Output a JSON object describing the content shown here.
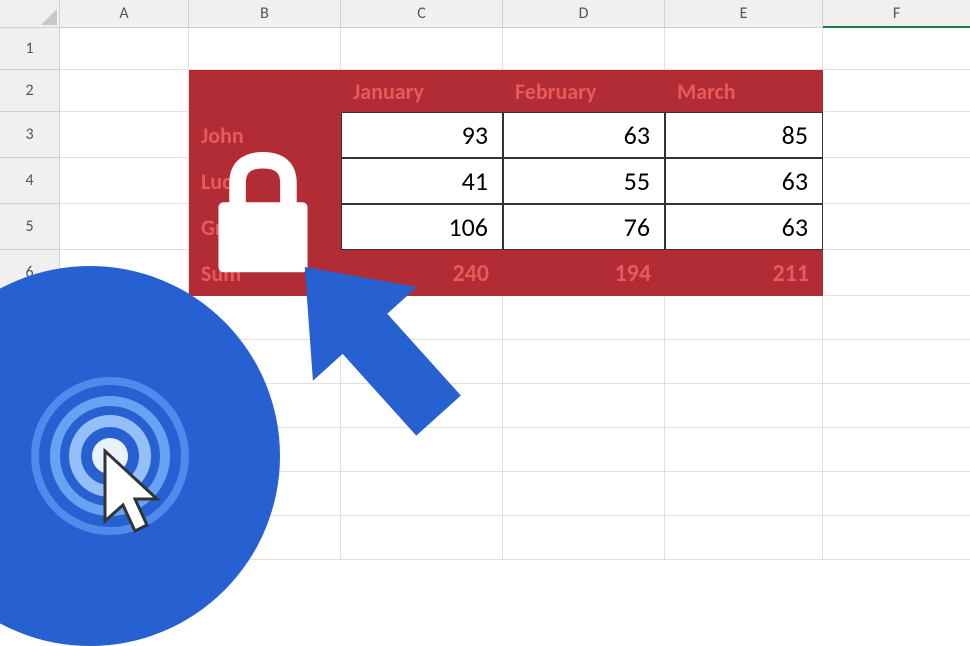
{
  "columns": [
    "A",
    "B",
    "C",
    "D",
    "E",
    "F"
  ],
  "rows": [
    "1",
    "2",
    "3",
    "4",
    "5",
    "6"
  ],
  "selected_column": "F",
  "table": {
    "months": {
      "c": "January",
      "d": "February",
      "e": "March"
    },
    "names": {
      "r3": "John",
      "r4": "Lucy",
      "r5": "Grace"
    },
    "data": {
      "r3": {
        "c": "93",
        "d": "63",
        "e": "85"
      },
      "r4": {
        "c": "41",
        "d": "55",
        "e": "63"
      },
      "r5": {
        "c": "106",
        "d": "76",
        "e": "63"
      }
    },
    "sum_label": "Sum",
    "sums": {
      "c": "240",
      "d": "194",
      "e": "211"
    }
  },
  "colors": {
    "highlight_bg": "#b22c36",
    "highlight_text": "#e85a5a",
    "arrow": "#2760d0",
    "lock": "#ffffff",
    "selected_border": "#1a7e43"
  },
  "chart_data": {
    "type": "table",
    "title": "",
    "columns": [
      "",
      "January",
      "February",
      "March"
    ],
    "rows": [
      [
        "John",
        93,
        63,
        85
      ],
      [
        "Lucy",
        41,
        55,
        63
      ],
      [
        "Grace",
        106,
        76,
        63
      ],
      [
        "Sum",
        240,
        194,
        211
      ]
    ]
  }
}
